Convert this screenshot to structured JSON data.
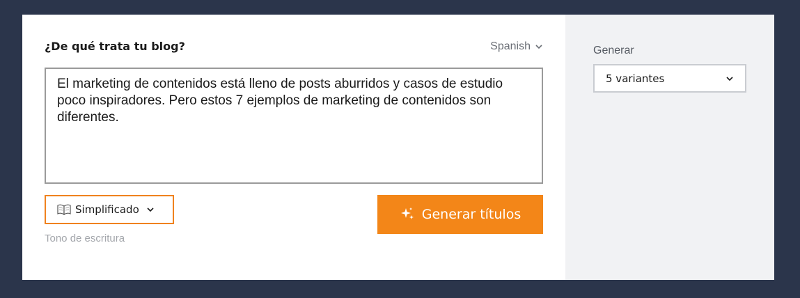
{
  "form": {
    "question": "¿De qué trata tu blog?",
    "language": "Spanish",
    "topic_text": "El marketing de contenidos está lleno de posts aburridos y casos de estudio poco inspiradores. Pero estos 7 ejemplos de marketing de contenidos son diferentes.",
    "tone": {
      "icon": "book-icon",
      "value": "Simplificado",
      "label": "Tono de escritura"
    },
    "generate_button": {
      "icon": "sparkles-icon",
      "label": "Generar títulos"
    }
  },
  "sidebar": {
    "label": "Generar",
    "variants_value": "5 variantes"
  },
  "colors": {
    "accent": "#f38618",
    "background": "#2b354b",
    "sidebar_bg": "#f1f2f4"
  }
}
